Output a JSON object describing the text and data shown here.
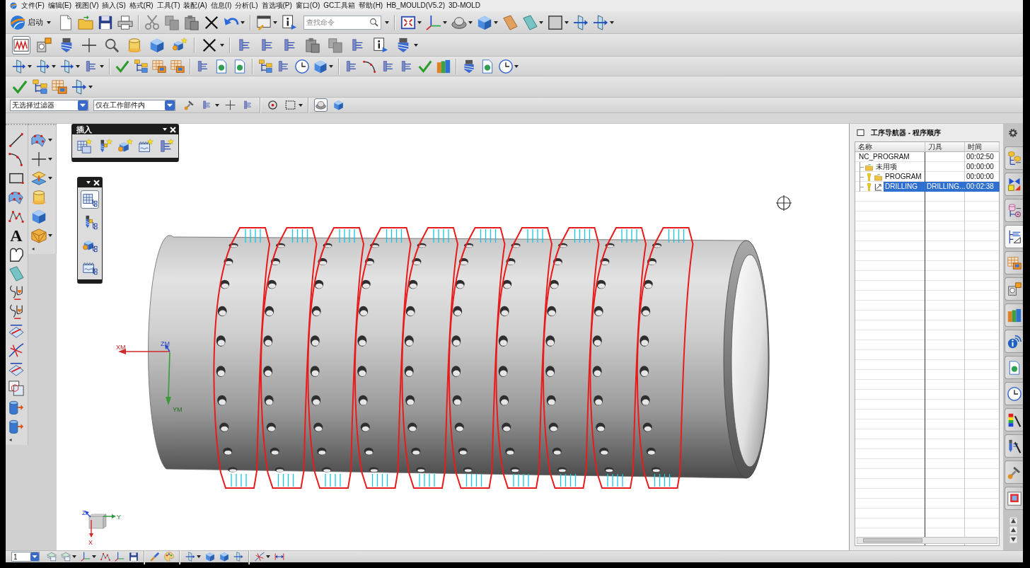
{
  "menu_bar": {
    "items": [
      "文件(F)",
      "编辑(E)",
      "视图(V)",
      "插入(S)",
      "格式(R)",
      "工具(T)",
      "装配(A)",
      "信息(I)",
      "分析(L)",
      "首选项(P)",
      "窗口(O)",
      "GC工具箱",
      "帮助(H)",
      "HB_MOULD(V5.2)",
      "3D-MOLD"
    ]
  },
  "standard_toolbar": {
    "start_button": "启动",
    "search": {
      "placeholder": "查找命令"
    }
  },
  "operation_toolbar": {
    "buttons": [
      {
        "pressed": true
      },
      {
        "pressed": false
      },
      {
        "pressed": false
      },
      {
        "pressed": false
      },
      {
        "pressed": false
      },
      {
        "pressed": false
      },
      {
        "pressed": false
      },
      {
        "pressed": false
      },
      {
        "pressed": false
      },
      {
        "pressed": false
      },
      {
        "pressed": false
      },
      {
        "pressed": false
      },
      {
        "pressed": false
      },
      {
        "pressed": false
      },
      {
        "pressed": false
      },
      {
        "pressed": false
      },
      {
        "pressed": false
      }
    ]
  },
  "selection_bar": {
    "filters": [
      "无选择过滤器",
      "仅在工作部件内"
    ],
    "buttons": [
      {
        "pressed": false
      },
      {
        "pressed": false
      },
      {
        "pressed": false
      },
      {
        "pressed": false
      },
      {
        "pressed": false
      },
      {
        "pressed": false
      },
      {
        "pressed": true
      },
      {
        "pressed": false
      }
    ]
  },
  "insert_toolbar": {
    "title": "插入"
  },
  "view_toolbar": {
    "buttons": [
      {
        "pressed": true
      },
      {
        "pressed": false
      },
      {
        "pressed": false
      },
      {
        "pressed": false
      }
    ]
  },
  "curve_toolbar": {
    "text_tool": "A"
  },
  "graphics": {
    "wcs_axes": [
      "XM",
      "ZM",
      "YM"
    ],
    "view_triad": [
      "Z",
      "Y",
      "X"
    ]
  },
  "operation_navigator": {
    "title": "工序导航器 - 程序顺序",
    "columns": [
      "名称",
      "刀具",
      "时间"
    ],
    "rows": [
      {
        "name": "NC_PROGRAM",
        "time": "00:02:50",
        "selected": false,
        "needs_regenerate": false,
        "children": [
          {
            "kind": "group",
            "name": "未用项",
            "time": "00:00:00",
            "selected": false,
            "needs_regenerate": false
          },
          {
            "kind": "group",
            "name": "PROGRAM",
            "time": "00:00:00",
            "selected": false,
            "needs_regenerate": true
          },
          {
            "kind": "operation",
            "name": "DRILLING",
            "tool": "DRILLING...",
            "time": "00:02:38",
            "selected": true,
            "needs_regenerate": true
          }
        ]
      }
    ]
  },
  "resource_bar": {
    "tabs": [
      {
        "selected": false
      },
      {
        "selected": false
      },
      {
        "selected": false
      },
      {
        "selected": true
      },
      {
        "selected": false
      },
      {
        "selected": false
      },
      {
        "selected": false
      },
      {
        "selected": false
      },
      {
        "selected": false
      },
      {
        "selected": false
      },
      {
        "selected": false
      },
      {
        "selected": false
      },
      {
        "selected": false
      },
      {
        "selected": false
      }
    ]
  },
  "utility_toolbar": {
    "layer": "1"
  }
}
